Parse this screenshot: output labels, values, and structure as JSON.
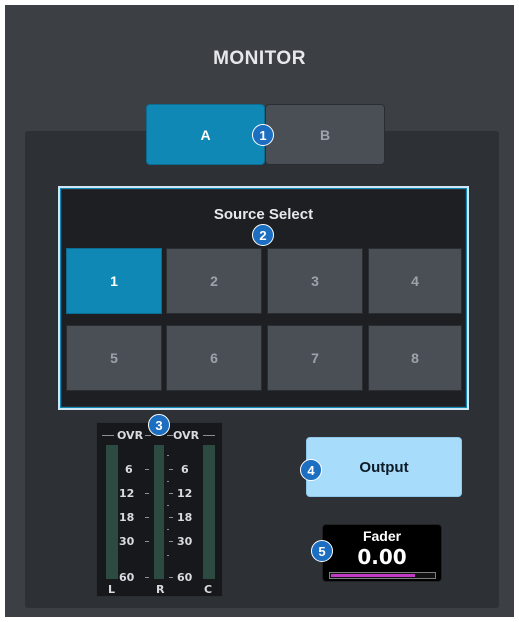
{
  "monitor": {
    "title": "MONITOR",
    "tabs": [
      {
        "label": "A",
        "active": true
      },
      {
        "label": "B",
        "active": false
      }
    ]
  },
  "source_select": {
    "title": "Source Select",
    "buttons": [
      "1",
      "2",
      "3",
      "4",
      "5",
      "6",
      "7",
      "8"
    ],
    "active": "1"
  },
  "meter": {
    "ovr_label": "OVR",
    "scale": [
      "6",
      "12",
      "18",
      "30",
      "60"
    ],
    "channels": [
      "L",
      "R",
      "C"
    ]
  },
  "output": {
    "label": "Output"
  },
  "fader": {
    "label": "Fader",
    "value": "0.00",
    "level": 0.82
  },
  "callouts": [
    "1",
    "2",
    "3",
    "4",
    "5"
  ],
  "colors": {
    "background": "#3c3f44",
    "panel": "#2d3035",
    "accent": "#0f88b6",
    "button_inactive": "#4a4e55",
    "output_button": "#a7dcfb",
    "fader_fill": "#c13ac6",
    "callout": "#1b6ec0"
  }
}
